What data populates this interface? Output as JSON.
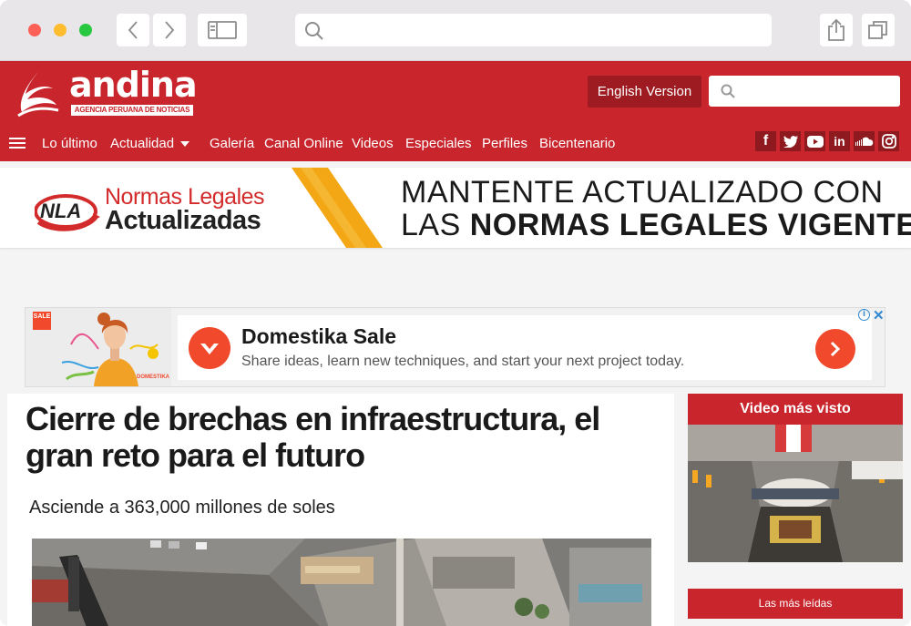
{
  "browser": {
    "url_value": ""
  },
  "site": {
    "logo": "andina",
    "logo_subtitle": "AGENCIA PERUANA DE NOTICIAS",
    "english_button": "English Version",
    "search_placeholder": "",
    "nav": [
      "Lo último",
      "Actualidad",
      "Galería",
      "Canal Online",
      "Videos",
      "Especiales",
      "Perfiles",
      "Bicentenario"
    ],
    "social": [
      "facebook",
      "twitter",
      "youtube",
      "linkedin",
      "soundcloud",
      "instagram"
    ]
  },
  "banner": {
    "brand": "NLA",
    "title1": "Normas Legales",
    "title2": "Actualizadas",
    "line1": "MANTENTE ACTUALIZADO CON",
    "line2_prefix": "LAS ",
    "line2_bold": "NORMAS LEGALES VIGENTES"
  },
  "ad": {
    "badge": "SALE",
    "image_brand": "DOMESTIKA",
    "title": "Domestika Sale",
    "description": "Share ideas, learn new techniques, and start your next project today."
  },
  "article": {
    "headline": "Cierre de brechas en infraestructura, el gran reto para el futuro",
    "subheadline": "Asciende a 363,000 millones de soles"
  },
  "sidebar": {
    "video_title": "Video más visto",
    "most_read": "Las más leídas"
  },
  "colors": {
    "brand_red": "#c8252c",
    "dark_red": "#9e1b21",
    "domestika_orange": "#f0492b"
  }
}
